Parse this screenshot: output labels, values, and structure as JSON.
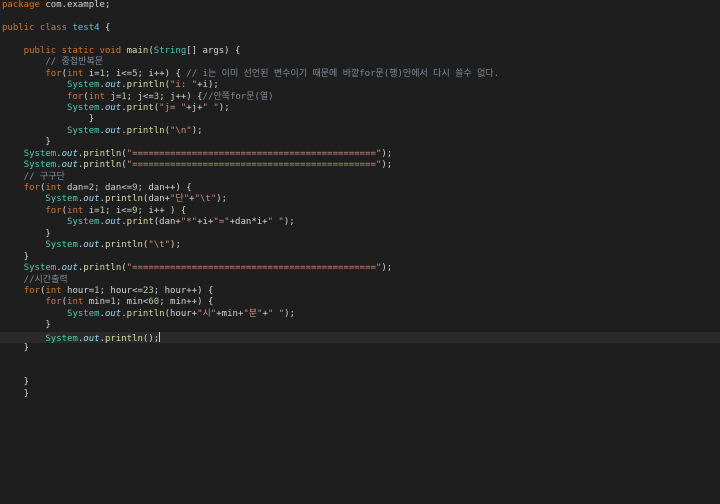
{
  "editor": {
    "lines": [
      [
        {
          "t": "package",
          "c": "kw"
        },
        {
          "t": " com.example;",
          "c": "pl"
        }
      ],
      [],
      [
        {
          "t": "public class ",
          "c": "kw"
        },
        {
          "t": "test4",
          "c": "cls"
        },
        {
          "t": " {",
          "c": "pl"
        }
      ],
      [],
      [
        {
          "t": "    public static void ",
          "c": "kw"
        },
        {
          "t": "main",
          "c": "fn"
        },
        {
          "t": "(",
          "c": "pl"
        },
        {
          "t": "String",
          "c": "ty"
        },
        {
          "t": "[] args) {",
          "c": "pl"
        }
      ],
      [
        {
          "t": "        // 중첩반복문",
          "c": "cm"
        }
      ],
      [
        {
          "t": "        ",
          "c": "pl"
        },
        {
          "t": "for",
          "c": "kw"
        },
        {
          "t": "(",
          "c": "pl"
        },
        {
          "t": "int",
          "c": "kw"
        },
        {
          "t": " i=",
          "c": "pl"
        },
        {
          "t": "1",
          "c": "num"
        },
        {
          "t": "; i<=",
          "c": "pl"
        },
        {
          "t": "5",
          "c": "num"
        },
        {
          "t": "; i++) { ",
          "c": "pl"
        },
        {
          "t": "// i는 이미 선언된 변수이기 때문에 바깥for문(행)안에서 다시 쓸수 없다.",
          "c": "cm"
        }
      ],
      [
        {
          "t": "            ",
          "c": "pl"
        },
        {
          "t": "System",
          "c": "ty"
        },
        {
          "t": ".",
          "c": "pl"
        },
        {
          "t": "out",
          "c": "fld"
        },
        {
          "t": ".",
          "c": "pl"
        },
        {
          "t": "println",
          "c": "fn"
        },
        {
          "t": "(",
          "c": "pl"
        },
        {
          "t": "\"i: \"",
          "c": "str"
        },
        {
          "t": "+i);",
          "c": "pl"
        }
      ],
      [
        {
          "t": "            ",
          "c": "pl"
        },
        {
          "t": "for",
          "c": "kw"
        },
        {
          "t": "(",
          "c": "pl"
        },
        {
          "t": "int",
          "c": "kw"
        },
        {
          "t": " j=",
          "c": "pl"
        },
        {
          "t": "1",
          "c": "num"
        },
        {
          "t": "; j<=",
          "c": "pl"
        },
        {
          "t": "3",
          "c": "num"
        },
        {
          "t": "; j++) {",
          "c": "pl"
        },
        {
          "t": "//안쪽for문(열)",
          "c": "cm"
        }
      ],
      [
        {
          "t": "            ",
          "c": "pl"
        },
        {
          "t": "System",
          "c": "ty"
        },
        {
          "t": ".",
          "c": "pl"
        },
        {
          "t": "out",
          "c": "fld"
        },
        {
          "t": ".",
          "c": "pl"
        },
        {
          "t": "print",
          "c": "fn"
        },
        {
          "t": "(",
          "c": "pl"
        },
        {
          "t": "\"j= \"",
          "c": "str"
        },
        {
          "t": "+j+",
          "c": "pl"
        },
        {
          "t": "\" \"",
          "c": "str"
        },
        {
          "t": ");",
          "c": "pl"
        }
      ],
      [
        {
          "t": "                }",
          "c": "pl"
        }
      ],
      [
        {
          "t": "            ",
          "c": "pl"
        },
        {
          "t": "System",
          "c": "ty"
        },
        {
          "t": ".",
          "c": "pl"
        },
        {
          "t": "out",
          "c": "fld"
        },
        {
          "t": ".",
          "c": "pl"
        },
        {
          "t": "println",
          "c": "fn"
        },
        {
          "t": "(",
          "c": "pl"
        },
        {
          "t": "\"\\n\"",
          "c": "str"
        },
        {
          "t": ");",
          "c": "pl"
        }
      ],
      [
        {
          "t": "        }",
          "c": "pl"
        }
      ],
      [
        {
          "t": "    ",
          "c": "pl"
        },
        {
          "t": "System",
          "c": "ty"
        },
        {
          "t": ".",
          "c": "pl"
        },
        {
          "t": "out",
          "c": "fld"
        },
        {
          "t": ".",
          "c": "pl"
        },
        {
          "t": "println",
          "c": "fn"
        },
        {
          "t": "(",
          "c": "pl"
        },
        {
          "t": "\"=============================================\"",
          "c": "str"
        },
        {
          "t": ");",
          "c": "pl"
        }
      ],
      [
        {
          "t": "    ",
          "c": "pl"
        },
        {
          "t": "System",
          "c": "ty"
        },
        {
          "t": ".",
          "c": "pl"
        },
        {
          "t": "out",
          "c": "fld"
        },
        {
          "t": ".",
          "c": "pl"
        },
        {
          "t": "println",
          "c": "fn"
        },
        {
          "t": "(",
          "c": "pl"
        },
        {
          "t": "\"=============================================\"",
          "c": "str"
        },
        {
          "t": ");",
          "c": "pl"
        }
      ],
      [
        {
          "t": "    // 구구단",
          "c": "cm"
        }
      ],
      [
        {
          "t": "    ",
          "c": "pl"
        },
        {
          "t": "for",
          "c": "kw"
        },
        {
          "t": "(",
          "c": "pl"
        },
        {
          "t": "int",
          "c": "kw"
        },
        {
          "t": " dan=",
          "c": "pl"
        },
        {
          "t": "2",
          "c": "num"
        },
        {
          "t": "; dan<=",
          "c": "pl"
        },
        {
          "t": "9",
          "c": "num"
        },
        {
          "t": "; dan++) {",
          "c": "pl"
        }
      ],
      [
        {
          "t": "        ",
          "c": "pl"
        },
        {
          "t": "System",
          "c": "ty"
        },
        {
          "t": ".",
          "c": "pl"
        },
        {
          "t": "out",
          "c": "fld"
        },
        {
          "t": ".",
          "c": "pl"
        },
        {
          "t": "println",
          "c": "fn"
        },
        {
          "t": "(dan+",
          "c": "pl"
        },
        {
          "t": "\"단\"",
          "c": "str"
        },
        {
          "t": "+",
          "c": "pl"
        },
        {
          "t": "\"\\t\"",
          "c": "str"
        },
        {
          "t": ");",
          "c": "pl"
        }
      ],
      [
        {
          "t": "        ",
          "c": "pl"
        },
        {
          "t": "for",
          "c": "kw"
        },
        {
          "t": "(",
          "c": "pl"
        },
        {
          "t": "int",
          "c": "kw"
        },
        {
          "t": " i=",
          "c": "pl"
        },
        {
          "t": "1",
          "c": "num"
        },
        {
          "t": "; i<=",
          "c": "pl"
        },
        {
          "t": "9",
          "c": "num"
        },
        {
          "t": "; i++ ) {",
          "c": "pl"
        }
      ],
      [
        {
          "t": "            ",
          "c": "pl"
        },
        {
          "t": "System",
          "c": "ty"
        },
        {
          "t": ".",
          "c": "pl"
        },
        {
          "t": "out",
          "c": "fld"
        },
        {
          "t": ".",
          "c": "pl"
        },
        {
          "t": "print",
          "c": "fn"
        },
        {
          "t": "(dan+",
          "c": "pl"
        },
        {
          "t": "\"*\"",
          "c": "str"
        },
        {
          "t": "+i+",
          "c": "pl"
        },
        {
          "t": "\"=\"",
          "c": "str"
        },
        {
          "t": "+dan*i+",
          "c": "pl"
        },
        {
          "t": "\" \"",
          "c": "str"
        },
        {
          "t": ");",
          "c": "pl"
        }
      ],
      [
        {
          "t": "        }",
          "c": "pl"
        }
      ],
      [
        {
          "t": "        ",
          "c": "pl"
        },
        {
          "t": "System",
          "c": "ty"
        },
        {
          "t": ".",
          "c": "pl"
        },
        {
          "t": "out",
          "c": "fld"
        },
        {
          "t": ".",
          "c": "pl"
        },
        {
          "t": "println",
          "c": "fn"
        },
        {
          "t": "(",
          "c": "pl"
        },
        {
          "t": "\"\\t\"",
          "c": "str"
        },
        {
          "t": ");",
          "c": "pl"
        }
      ],
      [
        {
          "t": "    }",
          "c": "pl"
        }
      ],
      [
        {
          "t": "    ",
          "c": "pl"
        },
        {
          "t": "System",
          "c": "ty"
        },
        {
          "t": ".",
          "c": "pl"
        },
        {
          "t": "out",
          "c": "fld"
        },
        {
          "t": ".",
          "c": "pl"
        },
        {
          "t": "println",
          "c": "fn"
        },
        {
          "t": "(",
          "c": "pl"
        },
        {
          "t": "\"=============================================\"",
          "c": "str"
        },
        {
          "t": ");",
          "c": "pl"
        }
      ],
      [
        {
          "t": "    //시간출력",
          "c": "cm"
        }
      ],
      [
        {
          "t": "    ",
          "c": "pl"
        },
        {
          "t": "for",
          "c": "kw"
        },
        {
          "t": "(",
          "c": "pl"
        },
        {
          "t": "int",
          "c": "kw"
        },
        {
          "t": " hour=",
          "c": "pl"
        },
        {
          "t": "1",
          "c": "num"
        },
        {
          "t": "; hour<=",
          "c": "pl"
        },
        {
          "t": "23",
          "c": "num"
        },
        {
          "t": "; hour++) {",
          "c": "pl"
        }
      ],
      [
        {
          "t": "        ",
          "c": "pl"
        },
        {
          "t": "for",
          "c": "kw"
        },
        {
          "t": "(",
          "c": "pl"
        },
        {
          "t": "int",
          "c": "kw"
        },
        {
          "t": " min=",
          "c": "pl"
        },
        {
          "t": "1",
          "c": "num"
        },
        {
          "t": "; min<",
          "c": "pl"
        },
        {
          "t": "60",
          "c": "num"
        },
        {
          "t": "; min++) {",
          "c": "pl"
        }
      ],
      [
        {
          "t": "            ",
          "c": "pl"
        },
        {
          "t": "System",
          "c": "ty"
        },
        {
          "t": ".",
          "c": "pl"
        },
        {
          "t": "out",
          "c": "fld"
        },
        {
          "t": ".",
          "c": "pl"
        },
        {
          "t": "println",
          "c": "fn"
        },
        {
          "t": "(hour+",
          "c": "pl"
        },
        {
          "t": "\"시\"",
          "c": "str"
        },
        {
          "t": "+min+",
          "c": "pl"
        },
        {
          "t": "\"분\"",
          "c": "str"
        },
        {
          "t": "+",
          "c": "pl"
        },
        {
          "t": "\" \"",
          "c": "str"
        },
        {
          "t": ");",
          "c": "pl"
        }
      ],
      [
        {
          "t": "        }",
          "c": "pl"
        }
      ],
      [
        {
          "t": "        ",
          "c": "pl"
        },
        {
          "t": "System",
          "c": "ty"
        },
        {
          "t": ".",
          "c": "pl"
        },
        {
          "t": "out",
          "c": "fld"
        },
        {
          "t": ".",
          "c": "pl"
        },
        {
          "t": "println",
          "c": "fn"
        },
        {
          "t": "();",
          "c": "pl"
        }
      ],
      [
        {
          "t": "    }",
          "c": "pl"
        }
      ],
      [],
      [],
      [
        {
          "t": "    }",
          "c": "pl"
        }
      ],
      [
        {
          "t": "    }",
          "c": "pl"
        }
      ]
    ],
    "current_line": 29,
    "colors": {
      "background": "#1e1e1e",
      "current_line": "#2a2a2a",
      "keyword": "#cc7832",
      "type": "#4ec9b0",
      "method": "#dcdcaa",
      "field": "#9cdcfe",
      "string": "#ce9178",
      "number": "#b5cea8",
      "comment": "#7f8c9a",
      "class_name": "#4fc1ff",
      "plain": "#d4d4d4"
    }
  }
}
